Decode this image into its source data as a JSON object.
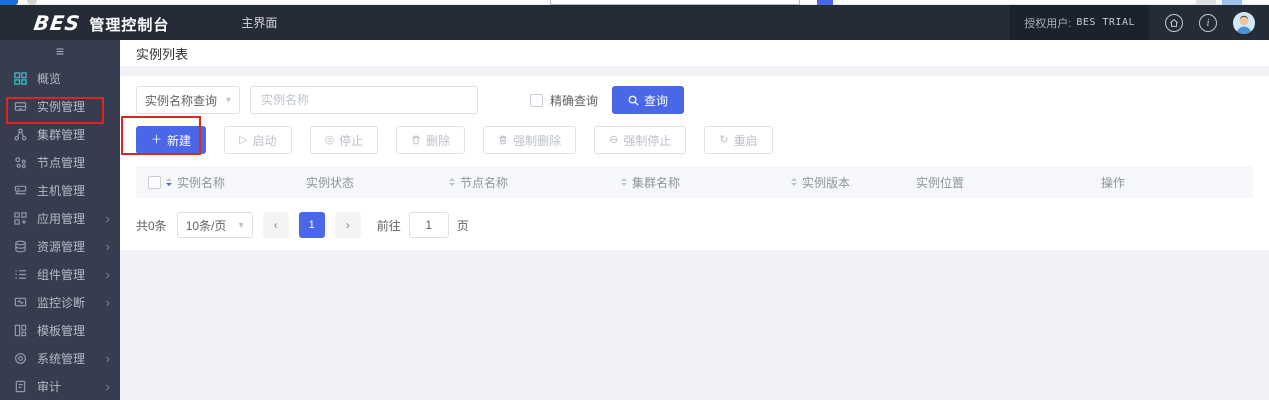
{
  "header": {
    "logo": "BES",
    "product_title": "管理控制台",
    "tab_main": "主界面",
    "license_label": "授权用户:",
    "license_value": "BES TRIAL"
  },
  "sidebar": {
    "items": [
      {
        "label": "概览",
        "icon": "overview-grid-icon"
      },
      {
        "label": "实例管理",
        "icon": "instance-icon"
      },
      {
        "label": "集群管理",
        "icon": "cluster-icon"
      },
      {
        "label": "节点管理",
        "icon": "node-icon"
      },
      {
        "label": "主机管理",
        "icon": "host-icon"
      },
      {
        "label": "应用管理",
        "icon": "app-icon",
        "expandable": true
      },
      {
        "label": "资源管理",
        "icon": "resource-icon",
        "expandable": true
      },
      {
        "label": "组件管理",
        "icon": "component-icon",
        "expandable": true
      },
      {
        "label": "监控诊断",
        "icon": "monitor-icon",
        "expandable": true
      },
      {
        "label": "模板管理",
        "icon": "template-icon"
      },
      {
        "label": "系统管理",
        "icon": "system-icon",
        "expandable": true
      },
      {
        "label": "审计",
        "icon": "audit-icon",
        "expandable": true
      }
    ]
  },
  "page": {
    "breadcrumb": "实例列表"
  },
  "search": {
    "field_selector_value": "实例名称查询",
    "input_placeholder": "实例名称",
    "exact_label": "精确查询",
    "query_label": "查询"
  },
  "toolbar": {
    "create": "新建",
    "start": "启动",
    "stop": "停止",
    "delete": "删除",
    "force_delete": "强制删除",
    "force_stop": "强制停止",
    "restart": "重启"
  },
  "table": {
    "columns": [
      {
        "label": "实例名称",
        "sortable": true,
        "sort": "desc"
      },
      {
        "label": "实例状态",
        "sortable": false
      },
      {
        "label": "节点名称",
        "sortable": true
      },
      {
        "label": "集群名称",
        "sortable": true
      },
      {
        "label": "实例版本",
        "sortable": true
      },
      {
        "label": "实例位置",
        "sortable": false
      },
      {
        "label": "操作",
        "sortable": false
      }
    ],
    "rows": []
  },
  "pagination": {
    "total": "共0条",
    "page_size": "10条/页",
    "current_page": "1",
    "goto_label": "前往",
    "goto_value": "1",
    "goto_suffix": "页"
  },
  "glyphs": {
    "collapse": "≡",
    "chevron_down": "▾",
    "chevron_right": "›",
    "prev": "‹",
    "next": "›",
    "plus": "＋",
    "start": "▷",
    "stop": "◎",
    "force_stop": "⊖",
    "restart": "↻",
    "info": "i"
  },
  "colors": {
    "primary": "#4a67e8",
    "header_bg": "#262b38",
    "sidebar_bg": "#373d4f",
    "teal_accent": "#2bc7c7",
    "annotation_red": "#e02323",
    "table_header_bg": "#f5f7fa"
  }
}
